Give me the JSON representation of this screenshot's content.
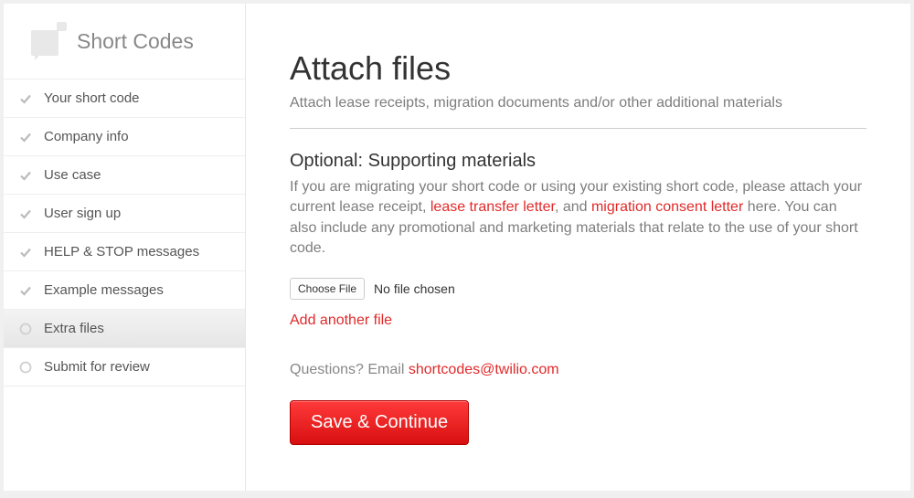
{
  "sidebar": {
    "title": "Short Codes",
    "items": [
      {
        "label": "Your short code",
        "state": "done"
      },
      {
        "label": "Company info",
        "state": "done"
      },
      {
        "label": "Use case",
        "state": "done"
      },
      {
        "label": "User sign up",
        "state": "done"
      },
      {
        "label": "HELP & STOP messages",
        "state": "done"
      },
      {
        "label": "Example messages",
        "state": "done"
      },
      {
        "label": "Extra files",
        "state": "active"
      },
      {
        "label": "Submit for review",
        "state": "pending"
      }
    ]
  },
  "main": {
    "title": "Attach files",
    "subtitle": "Attach lease receipts, migration documents and/or other additional materials",
    "section_heading": "Optional: Supporting materials",
    "body": {
      "part1": "If you are migrating your short code or using your existing short code, please attach your current lease receipt, ",
      "link1": "lease transfer letter",
      "part2": ", and ",
      "link2": "migration consent letter",
      "part3": " here. You can also include any promotional and marketing materials that relate to the use of your short code."
    },
    "file_input": {
      "button_label": "Choose File",
      "status": "No file chosen"
    },
    "add_another_label": "Add another file",
    "questions": {
      "prefix": "Questions? Email ",
      "email": "shortcodes@twilio.com"
    },
    "primary_button": "Save & Continue"
  }
}
